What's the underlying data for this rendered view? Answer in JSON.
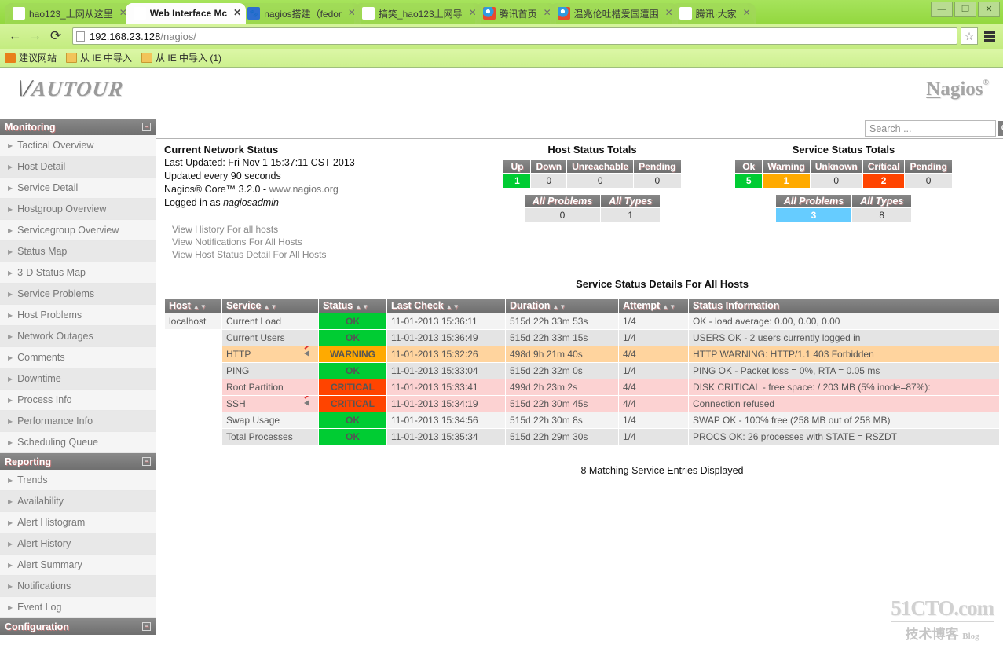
{
  "browser": {
    "tabs": [
      {
        "label": "hao123_上网从这里",
        "favicon": "hao-icon",
        "active": false
      },
      {
        "label": "Web Interface Mc",
        "favicon": "nagios-n-icon",
        "active": true
      },
      {
        "label": "nagios搭建（fedor",
        "favicon": "paw-icon",
        "active": false
      },
      {
        "label": "搞笑_hao123上网导",
        "favicon": "hao-icon",
        "active": false
      },
      {
        "label": "腾讯首页",
        "favicon": "qq-icon",
        "active": false
      },
      {
        "label": "温兆伦吐槽爱国遭围",
        "favicon": "qq-icon",
        "active": false
      },
      {
        "label": "腾讯·大家",
        "favicon": "dajia-icon",
        "active": false
      }
    ],
    "close_glyph": "✕",
    "window_controls": {
      "minimize": "—",
      "restore": "❐",
      "close": "✕"
    },
    "nav": {
      "back": "←",
      "forward": "→",
      "reload": "⟳"
    },
    "url_host": "192.168.23.128",
    "url_path": "/nagios/",
    "star_glyph": "☆",
    "bookmarks": [
      {
        "label": "建议网站",
        "icon": "bulb-icon"
      },
      {
        "label": "从 IE 中导入",
        "icon": "folder-icon"
      },
      {
        "label": "从 IE 中导入 (1)",
        "icon": "folder-icon"
      }
    ]
  },
  "header": {
    "left_logo": "AUTOUR",
    "left_logo_chev": "\\/",
    "right_logo": "Nagios",
    "right_logo_first": "N",
    "right_logo_rest": "agios",
    "right_logo_reg": "®"
  },
  "search": {
    "placeholder": "Search ...",
    "value": "",
    "icon": "search-icon"
  },
  "sidebar": {
    "sections": [
      {
        "title": "Monitoring",
        "collapse_glyph": "−",
        "items": [
          "Tactical Overview",
          "Host Detail",
          "Service Detail",
          "Hostgroup Overview",
          "Servicegroup Overview",
          "Status Map",
          "3-D Status Map",
          "Service Problems",
          "Host Problems",
          "Network Outages",
          "Comments",
          "Downtime",
          "Process Info",
          "Performance Info",
          "Scheduling Queue"
        ]
      },
      {
        "title": "Reporting",
        "collapse_glyph": "−",
        "items": [
          "Trends",
          "Availability",
          "Alert Histogram",
          "Alert History",
          "Alert Summary",
          "Notifications",
          "Event Log"
        ]
      },
      {
        "title": "Configuration",
        "collapse_glyph": "−",
        "items": []
      }
    ]
  },
  "network_status": {
    "title": "Current Network Status",
    "last_updated": "Last Updated: Fri Nov 1 15:37:11 CST 2013",
    "update_interval": "Updated every 90 seconds",
    "version_prefix": "Nagios® Core™ 3.2.0 - ",
    "version_url": "www.nagios.org",
    "logged_in_prefix": "Logged in as ",
    "logged_in_user": "nagiosadmin",
    "links": [
      "View History For all hosts",
      "View Notifications For All Hosts",
      "View Host Status Detail For All Hosts"
    ]
  },
  "host_totals": {
    "title": "Host Status Totals",
    "headers": [
      "Up",
      "Down",
      "Unreachable",
      "Pending"
    ],
    "values": [
      "1",
      "0",
      "0",
      "0"
    ],
    "value_colors": [
      "green",
      "none",
      "none",
      "none"
    ],
    "summary_headers": [
      "All Problems",
      "All Types"
    ],
    "summary_values": [
      "0",
      "1"
    ]
  },
  "service_totals": {
    "title": "Service Status Totals",
    "headers": [
      "Ok",
      "Warning",
      "Unknown",
      "Critical",
      "Pending"
    ],
    "values": [
      "5",
      "1",
      "0",
      "2",
      "0"
    ],
    "value_colors": [
      "green",
      "orange",
      "none",
      "red",
      "none"
    ],
    "summary_headers": [
      "All Problems",
      "All Types"
    ],
    "summary_values": [
      "3",
      "8"
    ],
    "summary_colors": [
      "blue",
      "none"
    ]
  },
  "service_table": {
    "title": "Service Status Details For All Hosts",
    "columns": [
      "Host",
      "Service",
      "Status",
      "Last Check",
      "Duration",
      "Attempt",
      "Status Information"
    ],
    "sort_glyphs": "▲▼",
    "rows": [
      {
        "host": "localhost",
        "service": "Current Load",
        "muted": false,
        "status": "OK",
        "status_class": "ok",
        "last_check": "11-01-2013 15:36:11",
        "duration": "515d 22h 33m 53s",
        "attempt": "1/4",
        "info": "OK - load average: 0.00, 0.00, 0.00",
        "row_class": "row-ok"
      },
      {
        "host": "",
        "service": "Current Users",
        "muted": false,
        "status": "OK",
        "status_class": "ok",
        "last_check": "11-01-2013 15:36:49",
        "duration": "515d 22h 33m 15s",
        "attempt": "1/4",
        "info": "USERS OK - 2 users currently logged in",
        "row_class": "row-ok alt"
      },
      {
        "host": "",
        "service": "HTTP",
        "muted": true,
        "status": "WARNING",
        "status_class": "warn",
        "last_check": "11-01-2013 15:32:26",
        "duration": "498d 9h 21m 40s",
        "attempt": "4/4",
        "info": "HTTP WARNING: HTTP/1.1 403 Forbidden",
        "row_class": "row-warn"
      },
      {
        "host": "",
        "service": "PING",
        "muted": false,
        "status": "OK",
        "status_class": "ok",
        "last_check": "11-01-2013 15:33:04",
        "duration": "515d 22h 32m 0s",
        "attempt": "1/4",
        "info": "PING OK - Packet loss = 0%, RTA = 0.05 ms",
        "row_class": "row-ok alt"
      },
      {
        "host": "",
        "service": "Root Partition",
        "muted": false,
        "status": "CRITICAL",
        "status_class": "crit",
        "last_check": "11-01-2013 15:33:41",
        "duration": "499d 2h 23m 2s",
        "attempt": "4/4",
        "info": "DISK CRITICAL - free space: / 203 MB (5% inode=87%):",
        "row_class": "row-crit"
      },
      {
        "host": "",
        "service": "SSH",
        "muted": true,
        "status": "CRITICAL",
        "status_class": "crit",
        "last_check": "11-01-2013 15:34:19",
        "duration": "515d 22h 30m 45s",
        "attempt": "4/4",
        "info": "Connection refused",
        "row_class": "row-crit"
      },
      {
        "host": "",
        "service": "Swap Usage",
        "muted": false,
        "status": "OK",
        "status_class": "ok",
        "last_check": "11-01-2013 15:34:56",
        "duration": "515d 22h 30m 8s",
        "attempt": "1/4",
        "info": "SWAP OK - 100% free (258 MB out of 258 MB)",
        "row_class": "row-ok"
      },
      {
        "host": "",
        "service": "Total Processes",
        "muted": false,
        "status": "OK",
        "status_class": "ok",
        "last_check": "11-01-2013 15:35:34",
        "duration": "515d 22h 29m 30s",
        "attempt": "1/4",
        "info": "PROCS OK: 26 processes with STATE = RSZDT",
        "row_class": "row-ok alt"
      }
    ],
    "footer": "8 Matching Service Entries Displayed"
  },
  "watermark": {
    "line1": "51CTO.com",
    "line2": "技术博客",
    "line2_suffix": "Blog"
  },
  "colors": {
    "ok_green": "#00cc33",
    "warning_orange": "#ffaa00",
    "critical_red": "#ff4400",
    "problems_blue": "#66ccff",
    "header_gray": "#7b7b7b",
    "browser_green": "#9ade4b"
  }
}
